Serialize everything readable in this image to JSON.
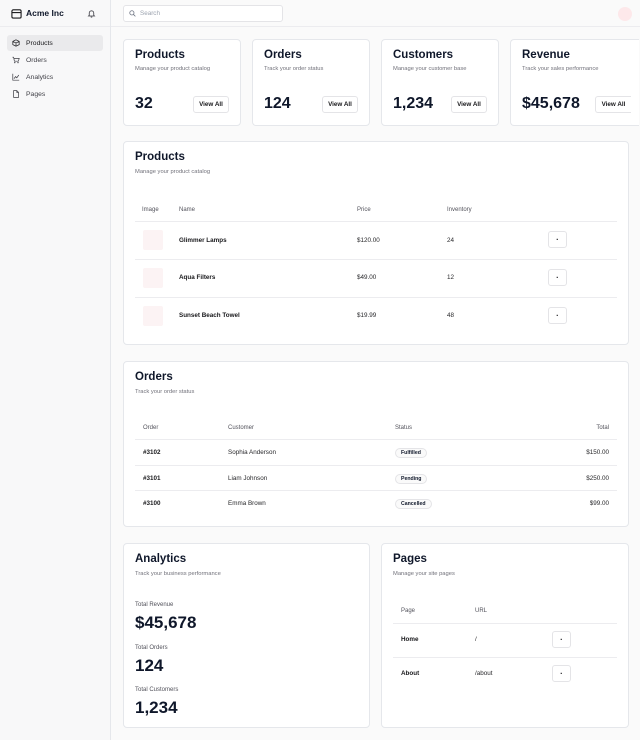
{
  "app": {
    "name": "Acme Inc"
  },
  "sidebar": {
    "items": [
      {
        "label": "Products",
        "icon": "package-icon",
        "active": true
      },
      {
        "label": "Orders",
        "icon": "cart-icon"
      },
      {
        "label": "Analytics",
        "icon": "line-chart-icon"
      },
      {
        "label": "Pages",
        "icon": "file-icon"
      }
    ]
  },
  "search": {
    "placeholder": "Search"
  },
  "stats": [
    {
      "title": "Products",
      "subtitle": "Manage your product catalog",
      "value": "32",
      "button": "View All"
    },
    {
      "title": "Orders",
      "subtitle": "Track your order status",
      "value": "124",
      "button": "View All"
    },
    {
      "title": "Customers",
      "subtitle": "Manage your customer base",
      "value": "1,234",
      "button": "View All"
    },
    {
      "title": "Revenue",
      "subtitle": "Track your sales performance",
      "value": "$45,678",
      "button": "View All"
    }
  ],
  "products": {
    "title": "Products",
    "subtitle": "Manage your product catalog",
    "columns": [
      "Image",
      "Name",
      "Price",
      "Inventory"
    ],
    "rows": [
      {
        "name": "Glimmer Lamps",
        "price": "$120.00",
        "inventory": "24",
        "action": "·"
      },
      {
        "name": "Aqua Filters",
        "price": "$49.00",
        "inventory": "12",
        "action": "·"
      },
      {
        "name": "Sunset Beach Towel",
        "price": "$19.99",
        "inventory": "48",
        "action": "·"
      }
    ]
  },
  "orders": {
    "title": "Orders",
    "subtitle": "Track your order status",
    "columns": [
      "Order",
      "Customer",
      "Status",
      "Total"
    ],
    "rows": [
      {
        "order": "#3102",
        "customer": "Sophia Anderson",
        "status": "Fulfilled",
        "total": "$150.00"
      },
      {
        "order": "#3101",
        "customer": "Liam Johnson",
        "status": "Pending",
        "total": "$250.00"
      },
      {
        "order": "#3100",
        "customer": "Emma Brown",
        "status": "Cancelled",
        "total": "$99.00"
      }
    ]
  },
  "analytics": {
    "title": "Analytics",
    "subtitle": "Track your business performance",
    "metrics": [
      {
        "label": "Total Revenue",
        "value": "$45,678"
      },
      {
        "label": "Total Orders",
        "value": "124"
      },
      {
        "label": "Total Customers",
        "value": "1,234"
      }
    ]
  },
  "pages": {
    "title": "Pages",
    "subtitle": "Manage your site pages",
    "columns": [
      "Page",
      "URL"
    ],
    "rows": [
      {
        "page": "Home",
        "url": "/",
        "action": "·"
      },
      {
        "page": "About",
        "url": "/about",
        "action": "·"
      }
    ]
  }
}
